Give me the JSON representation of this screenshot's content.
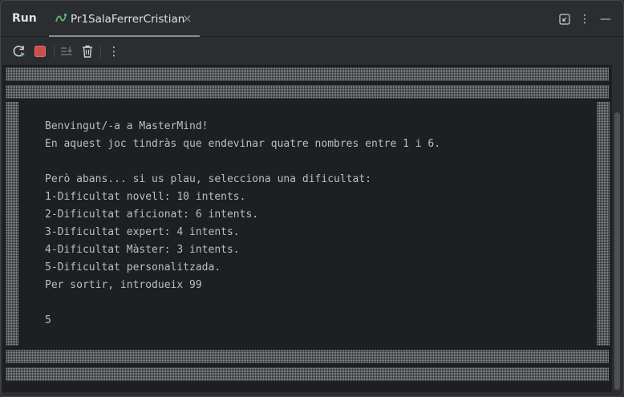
{
  "header": {
    "panel_title": "Run",
    "tab_label": "Pr1SalaFerrerCristian",
    "tab_close": "×",
    "options_glyph": "⋮",
    "minimize_glyph": "—"
  },
  "toolbar": {
    "icons": [
      "rerun-icon",
      "stop-icon",
      "scroll-to-end-icon",
      "trash-icon",
      "more-icon"
    ],
    "more_glyph": "⋮"
  },
  "console": {
    "lines": [
      "Benvingut/-a a MasterMind!",
      "En aquest joc tindràs que endevinar quatre nombres entre 1 i 6.",
      "",
      "Però abans... si us plau, selecciona una dificultat:",
      "1-Dificultat novell: 10 intents.",
      "2-Dificultat aficionat: 6 intents.",
      "3-Dificultat expert: 4 intents.",
      "4-Dificultat Màster: 3 intents.",
      "5-Dificultat personalitzada.",
      "Per sortir, introdueix 99",
      "",
      "5"
    ]
  },
  "colors": {
    "background": "#2b2d30",
    "console_bg": "#1e1f22",
    "text": "#bcbec4",
    "stop_red": "#c94f4f",
    "rerun_green": "#5fb865"
  }
}
